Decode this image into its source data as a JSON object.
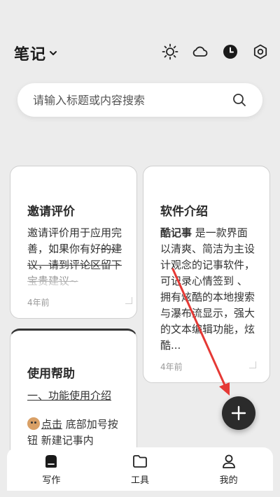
{
  "header": {
    "title": "笔记",
    "icons": [
      "dropdown-chevron",
      "sun-icon",
      "cloud-icon",
      "clock-icon",
      "settings-icon"
    ]
  },
  "search": {
    "placeholder": "请输入标题或内容搜索"
  },
  "notes": [
    {
      "title": "邀请评价",
      "body_plain": "邀请评价用于应用完善，如果你有好",
      "body_strike": "的建议，请到评论区留下宝贵建议~",
      "time": "4年前"
    },
    {
      "title": "软件介绍",
      "body_bold": "酷记事",
      "body_rest": " 是一款界面以清爽、简洁为主设计观念的记事软件，可记录心情签到 、拥有炫酷的本地搜索与瀑布流显示，强大的文本编辑功能，炫酷...",
      "time": "4年前"
    },
    {
      "title": "使用帮助",
      "subtitle": "一、功能使用介绍",
      "body_prefix": "点击",
      "body_rest": " 底部加号按钮 新建记事内"
    }
  ],
  "fab": {
    "icon": "plus-icon"
  },
  "bottom_nav": [
    {
      "label": "写作",
      "icon": "write-icon"
    },
    {
      "label": "工具",
      "icon": "folder-icon"
    },
    {
      "label": "我的",
      "icon": "person-icon"
    }
  ],
  "colors": {
    "background": "#ececec",
    "card": "#ffffff",
    "fab": "#2b2b2b",
    "annotation_arrow": "#e53935"
  }
}
